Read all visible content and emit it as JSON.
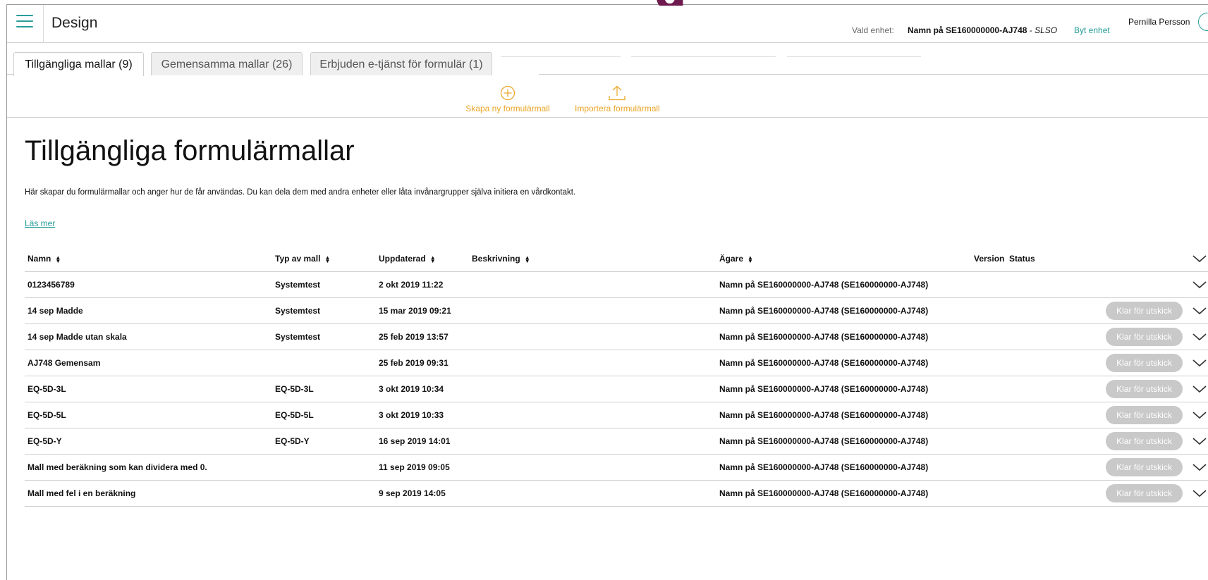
{
  "header": {
    "app_title": "Design",
    "unit_label": "Vald enhet:",
    "unit_name": "Namn på SE160000000-AJ748",
    "unit_separator": " - ",
    "unit_suffix": "SLSO",
    "change_unit": "Byt enhet",
    "user_name": "Pernilla Persson",
    "deco_letter": "g"
  },
  "tabs": [
    {
      "label": "Tillgängliga mallar (9)",
      "active": true
    },
    {
      "label": "Gemensamma mallar (26)",
      "active": false
    },
    {
      "label": "Erbjuden e-tjänst för formulär (1)",
      "active": false
    }
  ],
  "toolbar": {
    "create_label": "Skapa ny formulärmall",
    "import_label": "Importera formulärmall"
  },
  "content": {
    "title": "Tillgängliga formulärmallar",
    "description": "Här skapar du formulärmallar och anger hur de får användas. Du kan dela dem med andra enheter eller låta invånargrupper själva initiera en vårdkontakt.",
    "read_more": "Läs mer"
  },
  "table": {
    "headers": {
      "name": "Namn",
      "type": "Typ av mall",
      "updated": "Uppdaterad",
      "description": "Beskrivning",
      "owner": "Ägare",
      "version": "Version",
      "status": "Status"
    },
    "status_button": "Klar för utskick",
    "rows": [
      {
        "name": "0123456789",
        "type": "Systemtest",
        "updated": "2 okt 2019 11:22",
        "owner": "Namn på SE160000000-AJ748 (SE160000000-AJ748)",
        "has_status": false
      },
      {
        "name": "14 sep Madde",
        "type": "Systemtest",
        "updated": "15 mar 2019 09:21",
        "owner": "Namn på SE160000000-AJ748 (SE160000000-AJ748)",
        "has_status": true
      },
      {
        "name": "14 sep Madde utan skala",
        "type": "Systemtest",
        "updated": "25 feb 2019 13:57",
        "owner": "Namn på SE160000000-AJ748 (SE160000000-AJ748)",
        "has_status": true
      },
      {
        "name": "AJ748 Gemensam",
        "type": "",
        "updated": "25 feb 2019 09:31",
        "owner": "Namn på SE160000000-AJ748 (SE160000000-AJ748)",
        "has_status": true
      },
      {
        "name": "EQ-5D-3L",
        "type": "EQ-5D-3L",
        "updated": "3 okt 2019 10:34",
        "owner": "Namn på SE160000000-AJ748 (SE160000000-AJ748)",
        "has_status": true
      },
      {
        "name": "EQ-5D-5L",
        "type": "EQ-5D-5L",
        "updated": "3 okt 2019 10:33",
        "owner": "Namn på SE160000000-AJ748 (SE160000000-AJ748)",
        "has_status": true
      },
      {
        "name": "EQ-5D-Y",
        "type": "EQ-5D-Y",
        "updated": "16 sep 2019 14:01",
        "owner": "Namn på SE160000000-AJ748 (SE160000000-AJ748)",
        "has_status": true
      },
      {
        "name": "Mall med beräkning som kan dividera med 0.",
        "type": "",
        "updated": "11 sep 2019 09:05",
        "owner": "Namn på SE160000000-AJ748 (SE160000000-AJ748)",
        "has_status": true
      },
      {
        "name": "Mall med fel i en beräkning",
        "type": "",
        "updated": "9 sep 2019 14:05",
        "owner": "Namn på SE160000000-AJ748 (SE160000000-AJ748)",
        "has_status": true
      }
    ]
  },
  "colors": {
    "accent_teal": "#1f9a96",
    "action_orange": "#e8a424",
    "badge_grey": "#c9c9c9",
    "deco_purple": "#6e1a4e"
  },
  "icons": {
    "menu": "hamburger-icon",
    "create": "plus-circle-icon",
    "import": "upload-icon",
    "expand": "chevron-down-icon",
    "sort": "sort-icon"
  }
}
